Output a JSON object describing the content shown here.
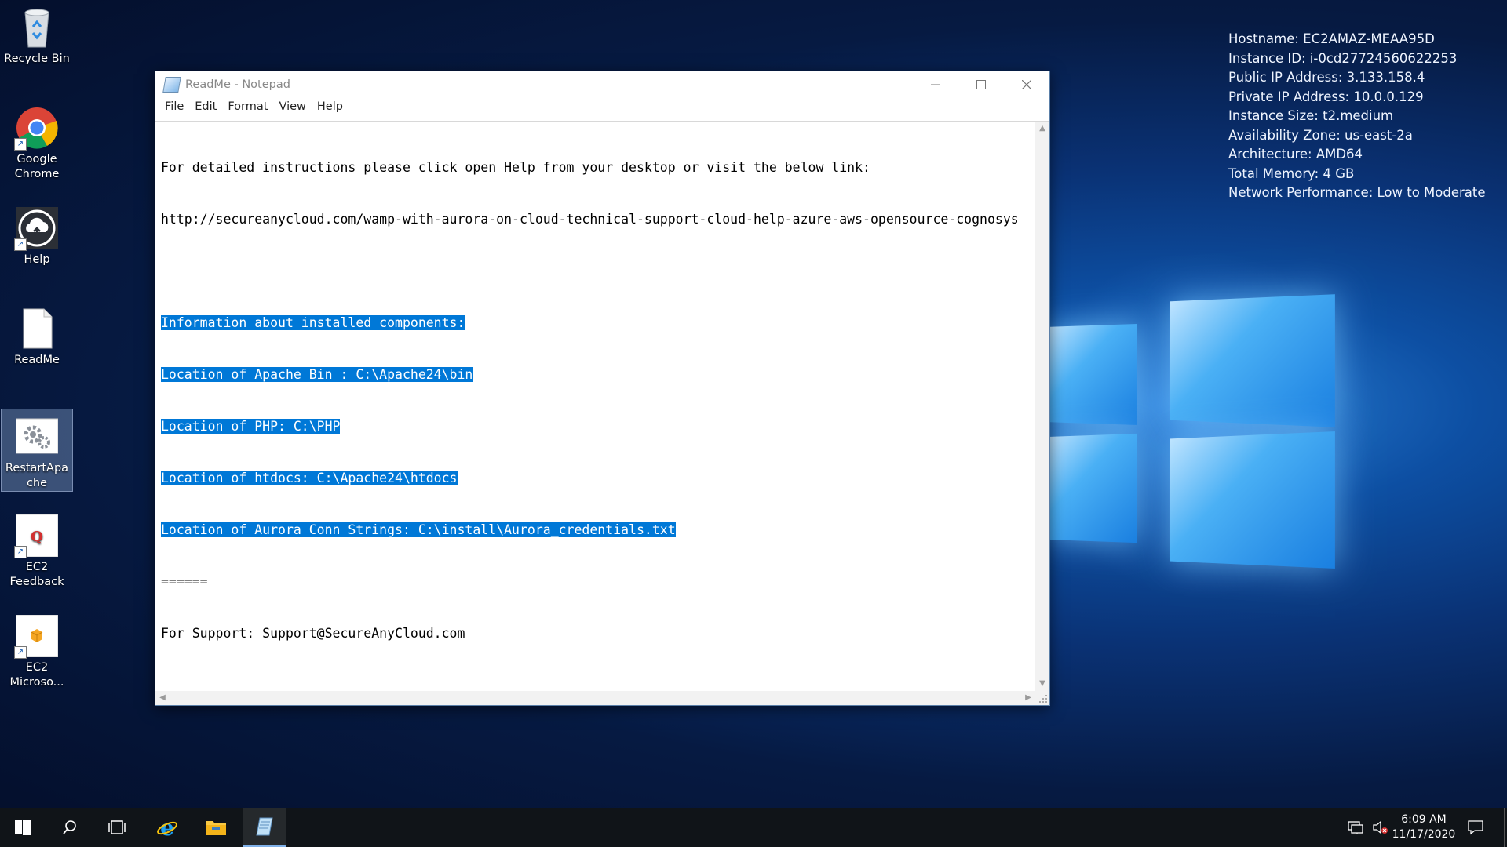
{
  "desktop": {
    "icons": [
      {
        "label": "Recycle Bin",
        "icon": "recycle-bin-icon"
      },
      {
        "label": "Google Chrome",
        "icon": "chrome-icon"
      },
      {
        "label": "Help",
        "icon": "help-cloud-icon"
      },
      {
        "label": "ReadMe",
        "icon": "text-file-icon"
      },
      {
        "label": "RestartApache",
        "icon": "gears-icon"
      },
      {
        "label": "EC2 Feedback",
        "icon": "feedback-icon"
      },
      {
        "label": "EC2 Microso...",
        "icon": "package-icon"
      }
    ],
    "sysinfo": [
      "Hostname: EC2AMAZ-MEAA95D",
      "Instance ID: i-0cd27724560622253",
      "Public IP Address: 3.133.158.4",
      "Private IP Address: 10.0.0.129",
      "Instance Size: t2.medium",
      "Availability Zone: us-east-2a",
      "Architecture: AMD64",
      "Total Memory: 4 GB",
      "Network Performance: Low to Moderate"
    ]
  },
  "notepad": {
    "title": "ReadMe - Notepad",
    "menu": [
      "File",
      "Edit",
      "Format",
      "View",
      "Help"
    ],
    "lines": [
      "For detailed instructions please click open Help from your desktop or visit the below link:",
      "http://secureanycloud.com/wamp-with-aurora-on-cloud-technical-support-cloud-help-azure-aws-opensource-cognosys",
      "",
      "Information about installed components:",
      "Location of Apache Bin : C:\\Apache24\\bin",
      "Location of PHP: C:\\PHP",
      "Location of htdocs: C:\\Apache24\\htdocs",
      "Location of Aurora Conn Strings: C:\\install\\Aurora_credentials.txt",
      "======",
      "For Support: Support@SecureAnyCloud.com"
    ]
  },
  "taskbar": {
    "time": "6:09 AM",
    "date": "11/17/2020"
  },
  "colors": {
    "selection": "#0078d7",
    "taskbar": "#101418"
  }
}
